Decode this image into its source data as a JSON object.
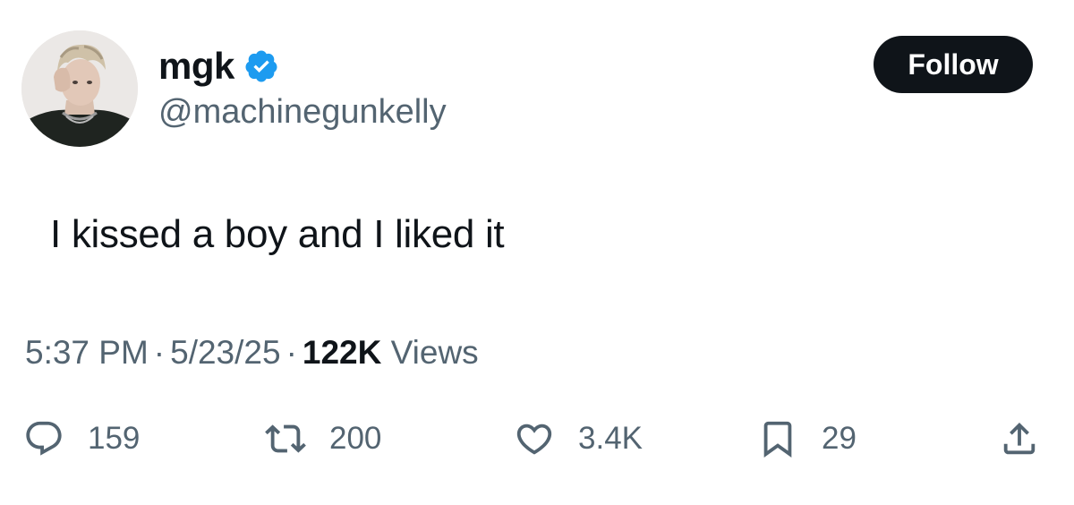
{
  "author": {
    "display_name": "mgk",
    "handle": "@machinegunkelly",
    "verified": true,
    "verified_color": "#1d9bf0"
  },
  "follow_button": {
    "label": "Follow"
  },
  "tweet": {
    "text": "I kissed a boy and I liked it",
    "time": "5:37 PM",
    "date": "5/23/25",
    "separator": "·",
    "views_count": "122K",
    "views_label": "Views"
  },
  "actions": {
    "reply": {
      "icon": "reply-icon",
      "count": "159"
    },
    "retweet": {
      "icon": "retweet-icon",
      "count": "200"
    },
    "like": {
      "icon": "heart-icon",
      "count": "3.4K"
    },
    "bookmark": {
      "icon": "bookmark-icon",
      "count": "29"
    },
    "share": {
      "icon": "share-icon"
    }
  },
  "colors": {
    "text_primary": "#0f1419",
    "text_secondary": "#536471",
    "button_bg": "#0f1419",
    "button_text": "#ffffff"
  }
}
